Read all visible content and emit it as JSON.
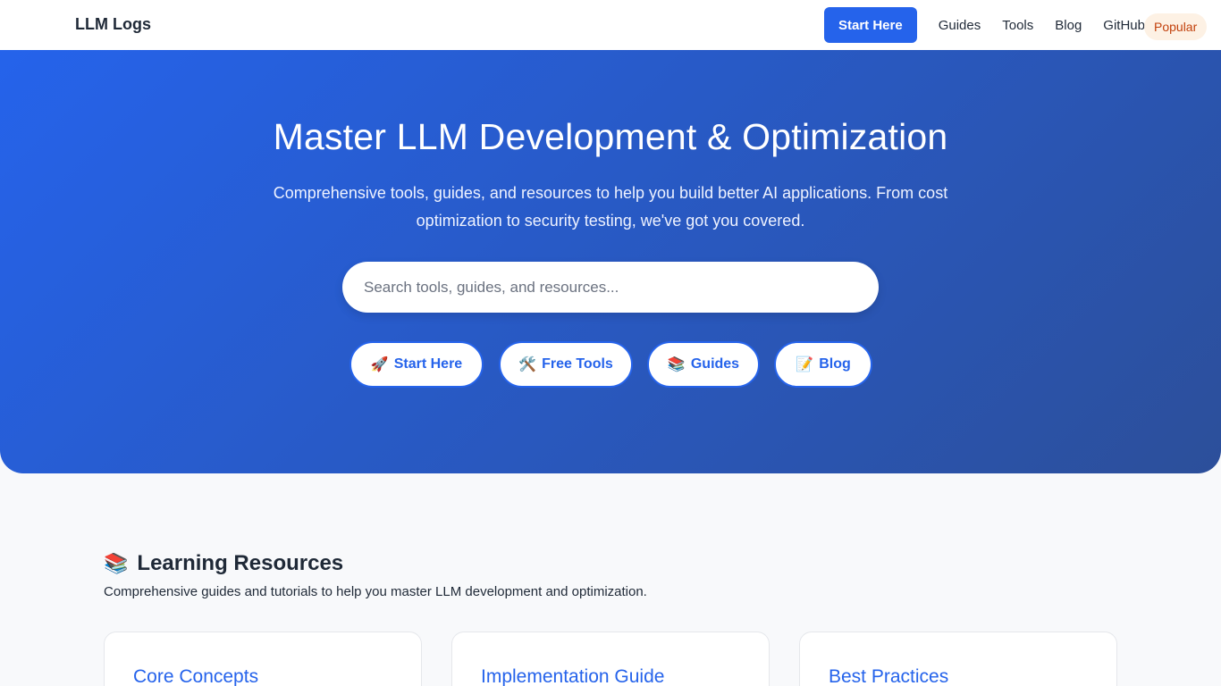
{
  "header": {
    "brand": "LLM Logs",
    "cta_label": "Start Here",
    "links": [
      "Guides",
      "Tools",
      "Blog",
      "GitHub"
    ],
    "badge": "Popular"
  },
  "hero": {
    "title": "Master LLM Development & Optimization",
    "subtitle": "Comprehensive tools, guides, and resources to help you build better AI applications. From cost optimization to security testing, we've got you covered.",
    "search_placeholder": "Search tools, guides, and resources...",
    "buttons": [
      {
        "icon": "🚀",
        "label": "Start Here"
      },
      {
        "icon": "🛠️",
        "label": "Free Tools"
      },
      {
        "icon": "📚",
        "label": "Guides"
      },
      {
        "icon": "📝",
        "label": "Blog"
      }
    ]
  },
  "learning": {
    "icon": "📚",
    "title": "Learning Resources",
    "description": "Comprehensive guides and tutorials to help you master LLM development and optimization.",
    "cards": [
      {
        "title": "Core Concepts"
      },
      {
        "title": "Implementation Guide"
      },
      {
        "title": "Best Practices"
      }
    ]
  },
  "colors": {
    "accent": "#2563eb",
    "hero_gradient_end": "#2c4f9a",
    "badge_text": "#c2410c",
    "badge_bg": "#fdf1e4"
  }
}
